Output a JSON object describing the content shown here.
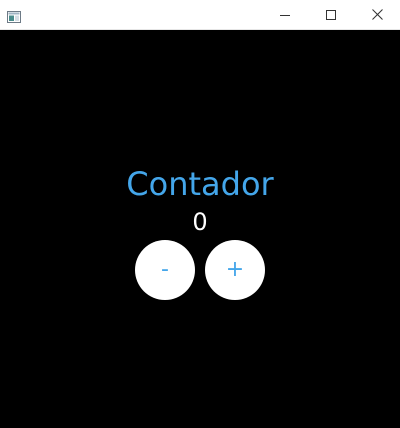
{
  "window": {
    "icon": "app-window-icon",
    "controls": {
      "minimize_icon": "minimize-icon",
      "maximize_icon": "maximize-icon",
      "close_icon": "close-icon"
    }
  },
  "app": {
    "title": "Contador",
    "count": "0",
    "decrement_label": "-",
    "increment_label": "+"
  },
  "colors": {
    "background": "#000000",
    "accent": "#44a6ea",
    "button_bg": "#ffffff",
    "count_text": "#ffffff"
  }
}
